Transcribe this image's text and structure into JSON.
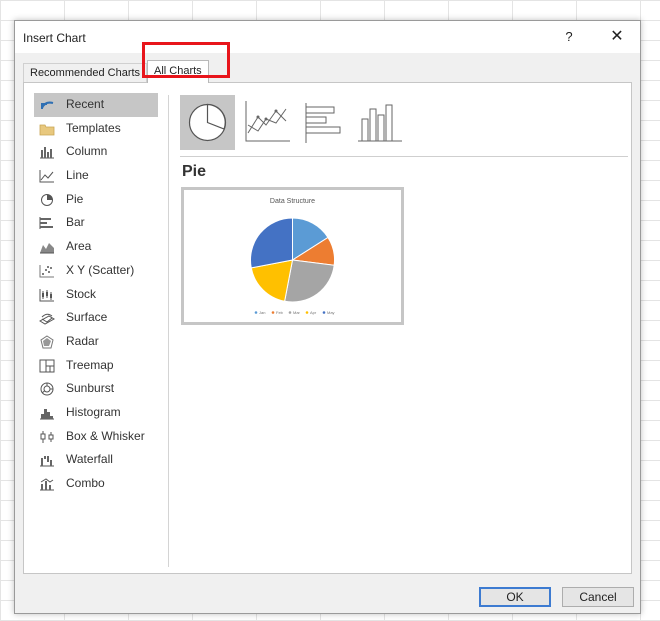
{
  "dialog": {
    "title": "Insert Chart",
    "help_label": "?",
    "close_label": "✕"
  },
  "tabs": {
    "recommended": "Recommended Charts",
    "all": "All Charts"
  },
  "sidebar": {
    "items": [
      {
        "label": "Recent",
        "icon": "recent-icon",
        "selected": true
      },
      {
        "label": "Templates",
        "icon": "folder-icon"
      },
      {
        "label": "Column",
        "icon": "column-chart-icon"
      },
      {
        "label": "Line",
        "icon": "line-chart-icon"
      },
      {
        "label": "Pie",
        "icon": "pie-chart-icon"
      },
      {
        "label": "Bar",
        "icon": "bar-chart-icon"
      },
      {
        "label": "Area",
        "icon": "area-chart-icon"
      },
      {
        "label": "X Y (Scatter)",
        "icon": "scatter-chart-icon"
      },
      {
        "label": "Stock",
        "icon": "stock-chart-icon"
      },
      {
        "label": "Surface",
        "icon": "surface-chart-icon"
      },
      {
        "label": "Radar",
        "icon": "radar-chart-icon"
      },
      {
        "label": "Treemap",
        "icon": "treemap-chart-icon"
      },
      {
        "label": "Sunburst",
        "icon": "sunburst-chart-icon"
      },
      {
        "label": "Histogram",
        "icon": "histogram-chart-icon"
      },
      {
        "label": "Box & Whisker",
        "icon": "box-whisker-chart-icon"
      },
      {
        "label": "Waterfall",
        "icon": "waterfall-chart-icon"
      },
      {
        "label": "Combo",
        "icon": "combo-chart-icon"
      }
    ]
  },
  "chart_type_thumbs": [
    {
      "icon": "pie-chart-icon",
      "selected": true
    },
    {
      "icon": "line-chart-icon"
    },
    {
      "icon": "bar-chart-icon"
    },
    {
      "icon": "column-chart-icon"
    }
  ],
  "main": {
    "heading": "Pie"
  },
  "preview": {
    "title": "Data Structure",
    "legend": [
      "Jan",
      "Feb",
      "Mar",
      "Apr",
      "May"
    ],
    "colors": [
      "#5b9bd5",
      "#ed7d31",
      "#a5a5a5",
      "#ffc000",
      "#4472c4"
    ]
  },
  "chart_data": {
    "type": "pie",
    "title": "Data Structure",
    "categories": [
      "Jan",
      "Feb",
      "Mar",
      "Apr",
      "May"
    ],
    "values": [
      16,
      11,
      26,
      19,
      28
    ],
    "colors": [
      "#5b9bd5",
      "#ed7d31",
      "#a5a5a5",
      "#ffc000",
      "#4472c4"
    ],
    "legend_position": "bottom"
  },
  "buttons": {
    "ok": "OK",
    "cancel": "Cancel"
  }
}
